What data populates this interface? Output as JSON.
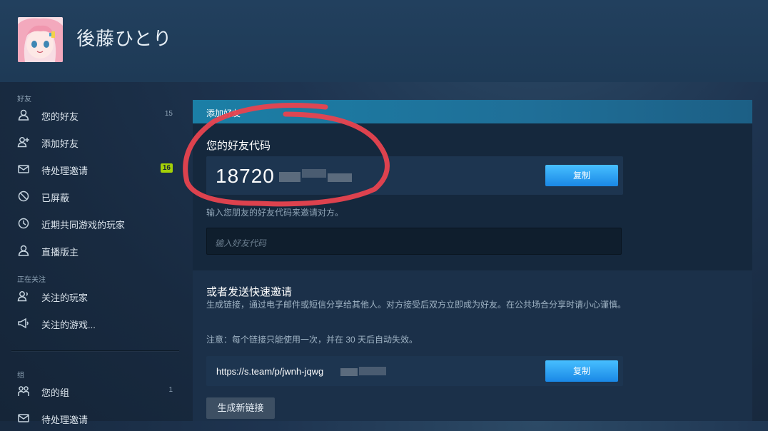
{
  "profile": {
    "username": "後藤ひとり",
    "avatar": "avatar-image"
  },
  "sidebar": {
    "friends_label": "好友",
    "items": [
      {
        "label": "您的好友",
        "count": "15",
        "icon": "person-icon"
      },
      {
        "label": "添加好友",
        "icon": "person-add-icon"
      },
      {
        "label": "待处理邀请",
        "badge": "16",
        "icon": "envelope-icon"
      },
      {
        "label": "已屏蔽",
        "icon": "block-icon"
      },
      {
        "label": "近期共同游戏的玩家",
        "icon": "clock-icon"
      },
      {
        "label": "直播版主",
        "icon": "person-icon"
      }
    ],
    "following_label": "正在关注",
    "following_items": [
      {
        "label": "关注的玩家",
        "icon": "person-follow-icon"
      },
      {
        "label": "关注的游戏...",
        "icon": "megaphone-icon"
      }
    ],
    "groups_label": "组",
    "group_items": [
      {
        "label": "您的组",
        "count": "1",
        "icon": "group-icon"
      },
      {
        "label": "待处理邀请",
        "icon": "envelope-icon"
      }
    ]
  },
  "panel": {
    "title": "添加好友",
    "friend_code_heading": "您的好友代码",
    "friend_code_visible": "18720",
    "copy_label": "复制",
    "code_hint": "输入您朋友的好友代码来邀请对方。",
    "code_input_placeholder": "输入好友代码",
    "quick_invite_heading": "或者发送快速邀请",
    "quick_invite_desc": "生成链接，通过电子邮件或短信分享给其他人。对方接受后双方立即成为好友。在公共场合分享时请小心谨慎。",
    "quick_invite_note": "注意：每个链接只能使用一次，并在 30 天后自动失效。",
    "invite_link_visible": "https://s.team/p/jwnh-jqwg",
    "copy_link_label": "复制",
    "generate_label": "生成新链接"
  },
  "colors": {
    "accent_blue": "#1a88e6",
    "badge_green": "#a4d007",
    "annotation_red": "#e8434f"
  }
}
